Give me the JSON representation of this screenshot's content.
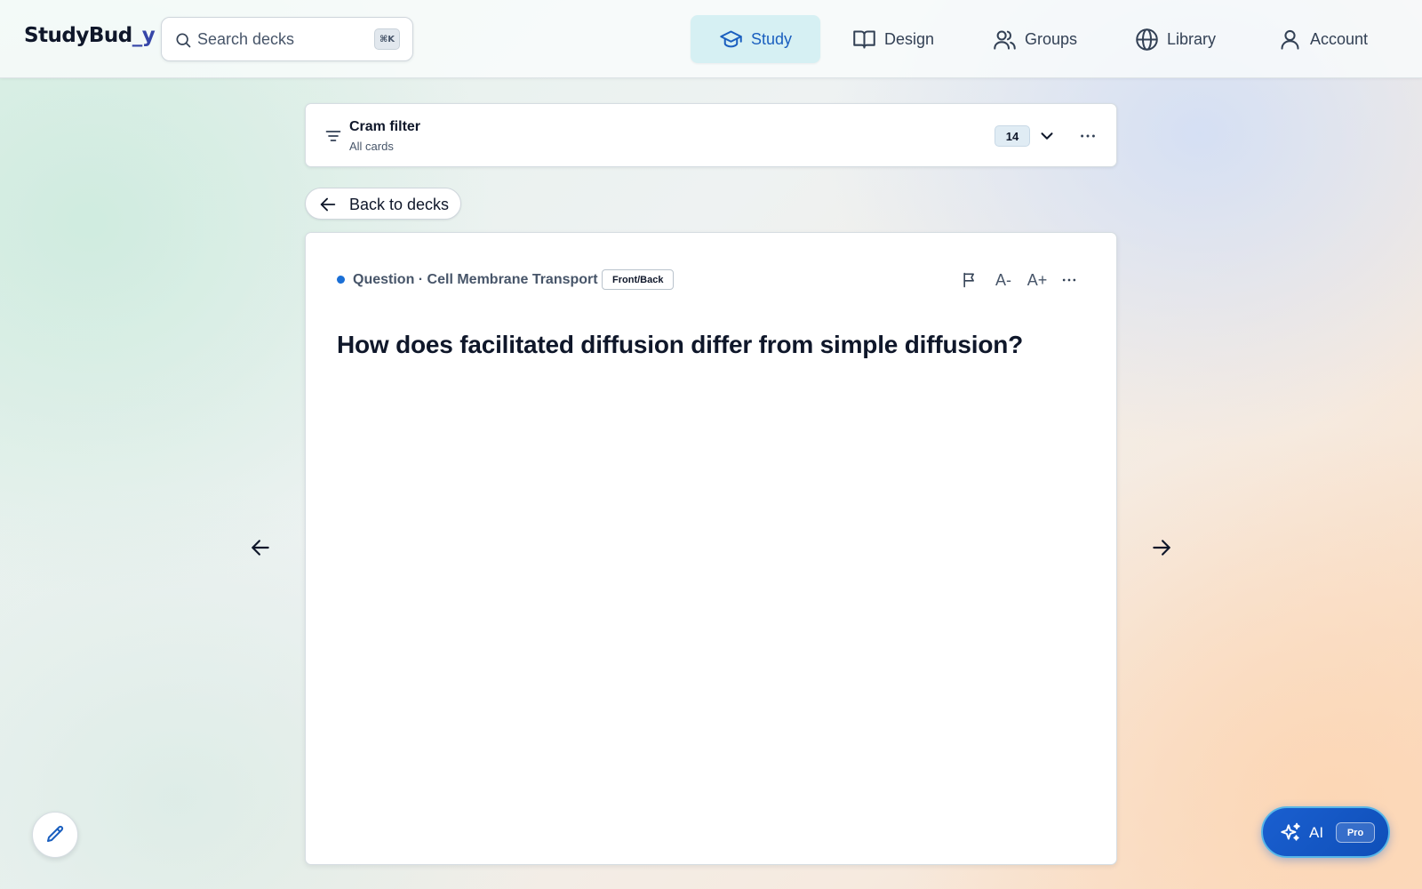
{
  "app": {
    "logo_main": "StudyBud",
    "logo_accent": "_y"
  },
  "search": {
    "placeholder": "Search decks",
    "value": "",
    "shortcut": "⌘K"
  },
  "nav": {
    "study": "Study",
    "design": "Design",
    "groups": "Groups",
    "library": "Library",
    "account": "Account",
    "active": "study"
  },
  "filter": {
    "title": "Cram filter",
    "subtitle": "All cards",
    "count": "14"
  },
  "back_button": {
    "label": "Back to decks"
  },
  "card": {
    "meta": "Question · Cell Membrane Transport",
    "type_badge": "Front/Back",
    "font_decrease": "A-",
    "font_increase": "A+",
    "question": "How does facilitated diffusion differ from simple diffusion?"
  },
  "ai_button": {
    "label": "AI",
    "badge": "Pro"
  },
  "colors": {
    "accent": "#1a5fbf",
    "active_nav_bg": "#d6f0f3",
    "ai_button": "#1a5fd0",
    "status_dot": "#1a6fd6"
  },
  "icons": {
    "search": "search-icon",
    "study": "graduation-cap-icon",
    "design": "open-book-icon",
    "groups": "users-icon",
    "library": "globe-icon",
    "account": "user-icon",
    "filter": "filter-lines-icon",
    "dropdown": "chevron-down-icon",
    "more": "more-horizontal-icon",
    "back": "arrow-left-icon",
    "flag": "flag-icon",
    "prev": "arrow-left-icon",
    "next": "arrow-right-icon",
    "edit": "pencil-icon",
    "ai": "sparkles-icon"
  }
}
